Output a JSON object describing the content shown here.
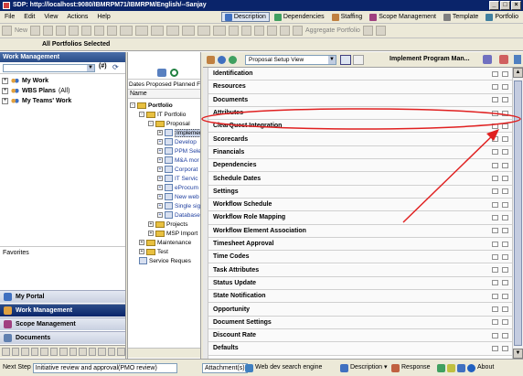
{
  "window": {
    "title": "SDP: http://localhost:9080/IBMRPM71/IBMRPM/English/--Sanjay"
  },
  "menu": [
    "File",
    "Edit",
    "View",
    "Actions",
    "Help"
  ],
  "perspectives": [
    {
      "label": "Description",
      "color": "#4070c0",
      "active": true
    },
    {
      "label": "Dependencies",
      "color": "#40a060",
      "active": false
    },
    {
      "label": "Staffing",
      "color": "#c08040",
      "active": false
    },
    {
      "label": "Scope Management",
      "color": "#a04080",
      "active": false
    },
    {
      "label": "Template",
      "color": "#808080",
      "active": false
    },
    {
      "label": "Portfolio",
      "color": "#4080a0",
      "active": false
    }
  ],
  "toolbar": {
    "new_label": "New",
    "aggregate_label": "Aggregate Portfolio"
  },
  "strip": {
    "label": "All Portfolios Selected"
  },
  "left": {
    "header": "Work Management",
    "hash": "(#)",
    "tree": [
      {
        "label": "My Work"
      },
      {
        "label": "WBS Plans",
        "suffix": "(All)"
      },
      {
        "label": "My Teams' Work"
      }
    ],
    "favorites": "Favorites",
    "nav": [
      {
        "label": "My Portal",
        "color": "#4070c0"
      },
      {
        "label": "Work Management",
        "color": "#e0a040"
      },
      {
        "label": "Scope Management",
        "color": "#a04080"
      },
      {
        "label": "Documents",
        "color": "#6080b0"
      }
    ]
  },
  "middle": {
    "columns": "Dates Proposed Planned F",
    "name_header": "Name",
    "tree": [
      {
        "label": "Portfolio",
        "indent": 0,
        "type": "folder",
        "bold": true,
        "expand": "-"
      },
      {
        "label": "IT Portfolio",
        "indent": 1,
        "type": "folder",
        "expand": "-"
      },
      {
        "label": "Proposal",
        "indent": 2,
        "type": "folder",
        "expand": "-"
      },
      {
        "label": "Implemen",
        "indent": 3,
        "type": "doc",
        "expand": "+",
        "selected": true
      },
      {
        "label": "Develop",
        "indent": 3,
        "type": "doc",
        "expand": "+",
        "blue": true
      },
      {
        "label": "PPM Sele",
        "indent": 3,
        "type": "doc",
        "expand": "+",
        "blue": true
      },
      {
        "label": "M&A mor",
        "indent": 3,
        "type": "doc",
        "expand": "+",
        "blue": true
      },
      {
        "label": "Corporat",
        "indent": 3,
        "type": "doc",
        "expand": "+",
        "blue": true
      },
      {
        "label": "IT Servic",
        "indent": 3,
        "type": "doc",
        "expand": "+",
        "blue": true
      },
      {
        "label": "eProcum",
        "indent": 3,
        "type": "doc",
        "expand": "+",
        "blue": true
      },
      {
        "label": "New web",
        "indent": 3,
        "type": "doc",
        "expand": "+",
        "blue": true
      },
      {
        "label": "Single sig",
        "indent": 3,
        "type": "doc",
        "expand": "+",
        "blue": true
      },
      {
        "label": "Database",
        "indent": 3,
        "type": "doc",
        "expand": "+",
        "blue": true
      },
      {
        "label": "Projects",
        "indent": 2,
        "type": "folder",
        "expand": "+"
      },
      {
        "label": "MSP Import",
        "indent": 2,
        "type": "folder",
        "expand": "+"
      },
      {
        "label": "Maintenance",
        "indent": 1,
        "type": "folder",
        "expand": "+"
      },
      {
        "label": "Test",
        "indent": 1,
        "type": "folder",
        "expand": "+"
      },
      {
        "label": "Service Reques",
        "indent": 1,
        "type": "doc",
        "expand": ""
      }
    ]
  },
  "right": {
    "view_select": "Proposal Setup View",
    "title": "Implement Program Man...",
    "sections": [
      "Identification",
      "Resources",
      "Documents",
      "Attributes",
      "ClearQuest Integration",
      "Scorecards",
      "Financials",
      "Dependencies",
      "Schedule Dates",
      "Settings",
      "Workflow Schedule",
      "Workflow Role Mapping",
      "Workflow Element Association",
      "Timesheet Approval",
      "Time Codes",
      "Task Attributes",
      "Status Update",
      "State Notification",
      "Opportunity",
      "Document Settings",
      "Discount Rate",
      "Defaults"
    ],
    "highlighted": "Attributes"
  },
  "status": {
    "next_step_label": "Next Step",
    "next_step_value": "Initiative review and approval(PMO review)",
    "attachments": "Attachment(s)",
    "search_engine": "Web dev search engine",
    "description": "Description",
    "response": "Response",
    "about": "About"
  },
  "annotation": {
    "circle_color": "#e02020",
    "arrow_color": "#e02020"
  }
}
